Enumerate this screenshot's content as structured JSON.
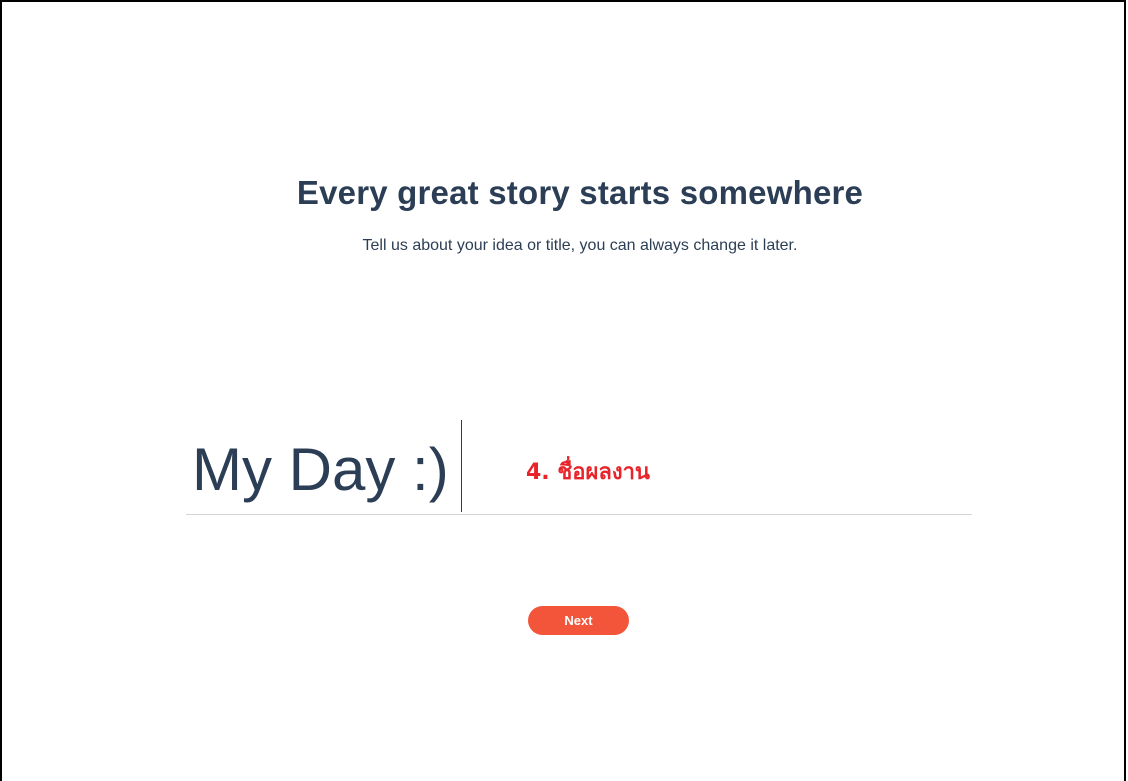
{
  "page": {
    "headline": "Every great story starts somewhere",
    "subheadline": "Tell us about your idea or title, you can always change it later."
  },
  "title_input": {
    "value": "My Day :)"
  },
  "annotation": {
    "text": "4. ชื่อผลงาน"
  },
  "next_button": {
    "label": "Next"
  },
  "colors": {
    "text_primary": "#2c3e55",
    "accent": "#f2553a",
    "annotation": "#e8242b",
    "divider": "#d4d4d4"
  }
}
